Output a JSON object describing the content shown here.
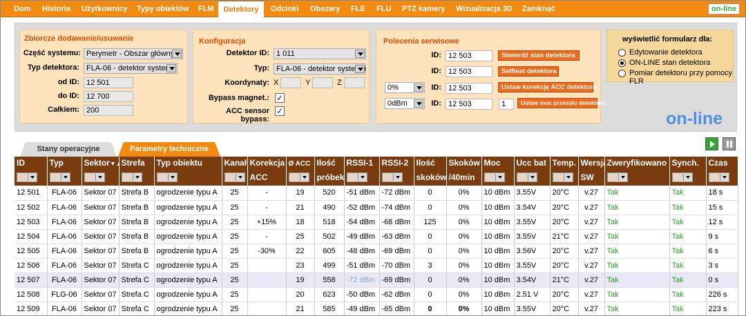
{
  "nav": {
    "items": [
      "Dom",
      "Historia",
      "Użytkownicy",
      "Typy obiektów",
      "FLM",
      "Detektory",
      "Odcinki",
      "Obszary",
      "FLE",
      "FLU",
      "PTZ kamery",
      "Wizualizacja 3D",
      "Zamknąć"
    ],
    "active": "Detektory",
    "status": "on-line"
  },
  "group": {
    "title": "Zbiorcze dodawanie/usuwanie",
    "system_label": "Część systemu:",
    "system_value": "Perymetr - Obszar główny",
    "type_label": "Typ detektora:",
    "type_value": "FLA-06 - detektor systemu",
    "from_label": "od ID:",
    "from_value": "12 501",
    "to_label": "do ID:",
    "to_value": "12 700",
    "total_label": "Całkiem:",
    "total_value": "200"
  },
  "config": {
    "title": "Konfiguracja",
    "detector_label": "Detektor ID:",
    "detector_value": "1 011",
    "type_label": "Typ:",
    "type_value": "FLA-06 - detektor systemu",
    "coords_label": "Koordynaty:",
    "x_label": "X",
    "y_label": "Y",
    "z_label": "Z",
    "bypass_label": "Bypass magnet.:",
    "acc_label": "ACC sensor bypass:",
    "check_mark": "✓"
  },
  "service": {
    "title": "Polecenia serwisowe",
    "id_label": "ID:",
    "rows": [
      {
        "pre": "",
        "id": "12 503",
        "button": "Stwierdź stan detektora",
        "extra": ""
      },
      {
        "pre": "",
        "id": "12 503",
        "button": "Selftest detektora",
        "extra": ""
      },
      {
        "pre": "0%",
        "id": "12 503",
        "button": "Ustaw korekcję ACC detektora",
        "extra": ""
      },
      {
        "pre": "0dBm",
        "id": "12 503",
        "button": "Ustaw moc przesyłu detektora",
        "extra": "1"
      }
    ]
  },
  "display": {
    "title": "wyświetlić formularz dla:",
    "options": [
      "Edytowanie detektora",
      "ON-LINE stan detektora",
      "Pomiar detektoru przy pomocy FLR"
    ],
    "selected": 1,
    "mode": "on-line"
  },
  "tabs": [
    "Stany operacyjne",
    "Parametry techniczne"
  ],
  "table": {
    "headers": [
      "ID",
      "Typ",
      "Sektor",
      "Strefa",
      "Typ obiektu",
      "Kanał",
      "Korekcja ACC",
      "Ø ACC",
      "Ilość próbek",
      "RSSI-1",
      "RSSI-2",
      "Ilość skoków",
      "Skoków /40min",
      "Moc",
      "Ucc bat",
      "Temp.",
      "Wersja SW",
      "Zweryfikowano",
      "Synch.",
      "Czas"
    ],
    "sort_mark": "▼▲",
    "rows": [
      [
        "12 501",
        "FLA-06",
        "Sektor 07",
        "Strefa B",
        "ogrodzenie typu A",
        "25",
        "-",
        "19",
        "520",
        "-51 dBm",
        "-72 dBm",
        "0",
        "0%",
        "10 dBm",
        "3.55V",
        "20°C",
        "v.27",
        "Tak",
        "Tak",
        "18 s"
      ],
      [
        "12 502",
        "FLA-06",
        "Sektor 07",
        "Strefa B",
        "ogrodzenie typu A",
        "25",
        "-",
        "21",
        "490",
        "-52 dBm",
        "-74 dBm",
        "0",
        "0%",
        "10 dBm",
        "3.54V",
        "20°C",
        "v.27",
        "Tak",
        "Tak",
        "15 s"
      ],
      [
        "12 503",
        "FLA-06",
        "Sektor 07",
        "Strefa B",
        "ogrodzenie typu A",
        "25",
        "+15%",
        "18",
        "518",
        "-54 dBm",
        "-68 dBm",
        "125",
        "0%",
        "10 dBm",
        "3.55V",
        "20°C",
        "v.27",
        "Tak",
        "Tak",
        "12 s"
      ],
      [
        "12 504",
        "FLA-06",
        "Sektor 07",
        "Strefa B",
        "ogrodzenie typu A",
        "25",
        "-",
        "25",
        "502",
        "-49 dBm",
        "-63 dBm",
        "0",
        "0%",
        "10 dBm",
        "3.55V",
        "21°C",
        "v.27",
        "Tak",
        "Tak",
        "9 s"
      ],
      [
        "12 505",
        "FLA-06",
        "Sektor 07",
        "Strefa B",
        "ogrodzenie typu A",
        "25",
        "-30%",
        "22",
        "605",
        "-48 dBm",
        "-69 dBm",
        "0",
        "0%",
        "10 dBm",
        "3.56V",
        "20°C",
        "v.27",
        "Tak",
        "Tak",
        "6 s"
      ],
      [
        "12 506",
        "FLA-06",
        "Sektor 07",
        "Strefa C",
        "ogrodzenie typu A",
        "25",
        "",
        "23",
        "499",
        "-51 dBm",
        "-70 dBm",
        "3",
        "0%",
        "10 dBm",
        "3.55V",
        "20°C",
        "v.27",
        "Tak",
        "Tak",
        "3 s"
      ],
      [
        "12 507",
        "FLA-06",
        "Sektor 07",
        "Strefa C",
        "ogrodzenie typu A",
        "25",
        "",
        "19",
        "558",
        "-72 dBm",
        "-69 dBm",
        "0",
        "0%",
        "10 dBm",
        "3.54V",
        "21°C",
        "v.27",
        "Tak",
        "Tak",
        "0 s"
      ],
      [
        "12 508",
        "FLG-06",
        "Sektor 07",
        "Strefa C",
        "ogrodzenie typu A",
        "25",
        "",
        "20",
        "623",
        "-50 dBm",
        "-62 dBm",
        "0",
        "0%",
        "10 dBm",
        "2.51 V",
        "20°C",
        "v.27",
        "Tak",
        "Tak",
        "226 s"
      ],
      [
        "12 509",
        "FLA-06",
        "Sektor 07",
        "Strefa C",
        "ogrodzenie typu A",
        "25",
        "",
        "21",
        "585",
        "-49 dBm",
        "-65 dBm",
        "0",
        "0%",
        "10 dBm",
        "3.55V",
        "20°C",
        "v.27",
        "Tak",
        "Tak",
        "223 s"
      ]
    ]
  },
  "colors": {
    "accent": "#f28a10",
    "header": "#7a3b0f",
    "ok": "#2a9a2a",
    "online": "#4f8fe6"
  }
}
